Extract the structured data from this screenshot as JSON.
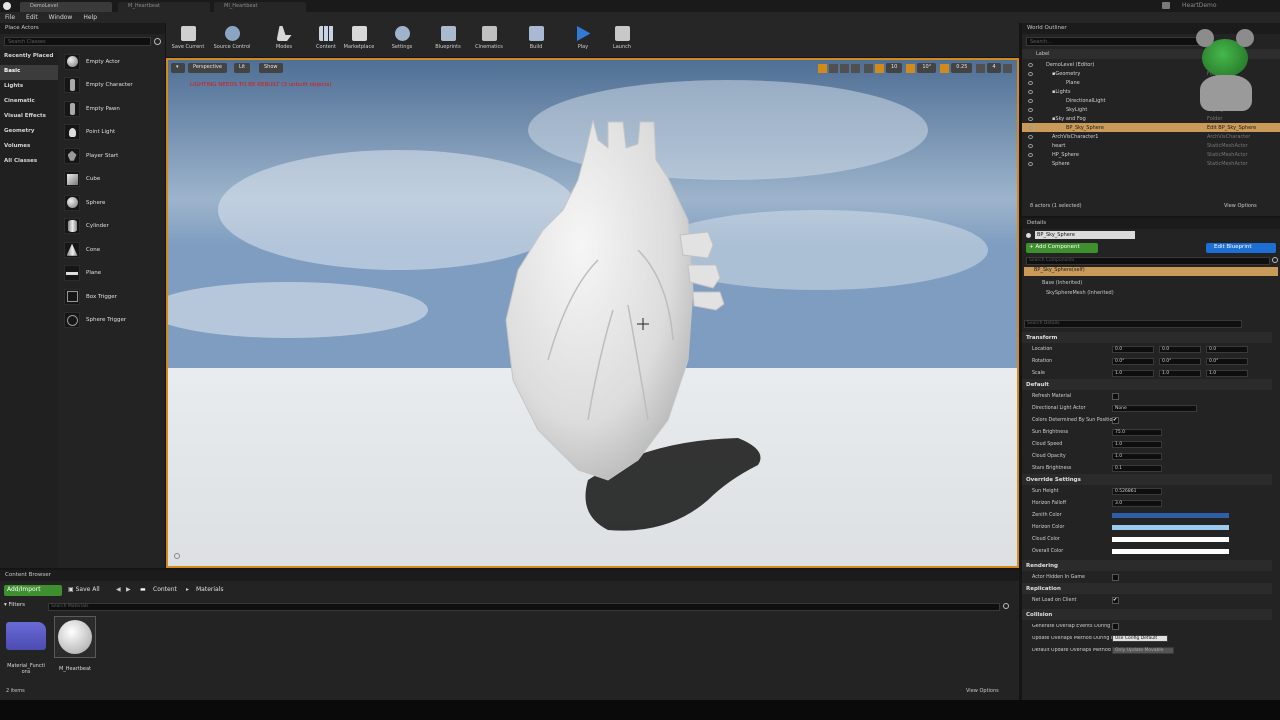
{
  "titlebar": {
    "tabs": [
      "DemoLevel",
      "M_Heartbeat",
      "MI_Heartbeat"
    ],
    "project": "HeartDemo"
  },
  "menubar": {
    "items": [
      "File",
      "Edit",
      "Window",
      "Help"
    ]
  },
  "place_actors": {
    "title": "Place Actors",
    "search_placeholder": "Search Classes",
    "categories": [
      "Recently Placed",
      "Basic",
      "Lights",
      "Cinematic",
      "Visual Effects",
      "Geometry",
      "Volumes",
      "All Classes"
    ],
    "selected_category": "Basic",
    "actors": [
      "Empty Actor",
      "Empty Character",
      "Empty Pawn",
      "Point Light",
      "Player Start",
      "Cube",
      "Sphere",
      "Cylinder",
      "Cone",
      "Plane",
      "Box Trigger",
      "Sphere Trigger"
    ]
  },
  "toolbar": {
    "buttons": [
      "Save Current",
      "Source Control",
      "Modes",
      "Content",
      "Marketplace",
      "Settings",
      "Blueprints",
      "Cinematics",
      "Build",
      "Play",
      "Launch"
    ]
  },
  "viewport": {
    "perspective": "Perspective",
    "lit": "Lit",
    "show": "Show",
    "warning": "LIGHTING NEEDS TO BE REBUILT (3 unbuilt objects)",
    "grid": "10",
    "angle": "10°",
    "scale": "0.25",
    "camera": "4"
  },
  "outliner": {
    "title": "World Outliner",
    "search_placeholder": "Search...",
    "col_label": "Label",
    "col_type": "Type",
    "rows": [
      {
        "label": "DemoLevel (Editor)",
        "type": "World"
      },
      {
        "label": "Geometry",
        "type": "Folder"
      },
      {
        "label": "Plane",
        "type": "StaticMeshActor"
      },
      {
        "label": "Lights",
        "type": "Folder"
      },
      {
        "label": "DirectionalLight",
        "type": "DirectionalLight"
      },
      {
        "label": "SkyLight",
        "type": "SkyLight"
      },
      {
        "label": "Sky and Fog",
        "type": "Folder"
      },
      {
        "label": "BP_Sky_Sphere",
        "type": "Edit BP_Sky_Sphere"
      },
      {
        "label": "ArchVisCharacter1",
        "type": "ArchVisCharacter"
      },
      {
        "label": "heart",
        "type": "StaticMeshActor"
      },
      {
        "label": "HP_Sphere",
        "type": "StaticMeshActor"
      },
      {
        "label": "Sphere",
        "type": "StaticMeshActor"
      }
    ],
    "status": "8 actors (1 selected)",
    "view_options": "View Options"
  },
  "details": {
    "title": "Details",
    "name": "BP_Sky_Sphere",
    "add_component": "+ Add Component",
    "edit_blueprint": "Edit Blueprint",
    "search_components": "Search Components",
    "components": [
      "BP_Sky_Sphere(self)",
      "Base (Inherited)",
      "SkySphereMesh (Inherited)"
    ],
    "search_details": "Search Details",
    "transform": {
      "title": "Transform",
      "location": [
        "0.0",
        "0.0",
        "0.0"
      ],
      "rotation": [
        "0.0°",
        "0.0°",
        "0.0°"
      ],
      "scale": [
        "1.0",
        "1.0",
        "1.0"
      ],
      "labels": [
        "Location",
        "Rotation",
        "Scale"
      ]
    },
    "default": {
      "title": "Default",
      "props": [
        {
          "label": "Refresh Material",
          "type": "check",
          "value": ""
        },
        {
          "label": "Directional Light Actor",
          "type": "select",
          "value": "None"
        },
        {
          "label": "Colors Determined By Sun Position",
          "type": "check",
          "value": "✔"
        },
        {
          "label": "Sun Brightness",
          "type": "num",
          "value": "75.0"
        },
        {
          "label": "Cloud Speed",
          "type": "num",
          "value": "1.0"
        },
        {
          "label": "Cloud Opacity",
          "type": "num",
          "value": "1.0"
        },
        {
          "label": "Stars Brightness",
          "type": "num",
          "value": "0.1"
        }
      ]
    },
    "override": {
      "title": "Override Settings",
      "props": [
        {
          "label": "Sun Height",
          "value": "0.526861",
          "color": ""
        },
        {
          "label": "Horizon Falloff",
          "value": "3.0",
          "color": ""
        },
        {
          "label": "Zenith Color",
          "value": "",
          "color": "#2e5fa6"
        },
        {
          "label": "Horizon Color",
          "value": "",
          "color": "#9cc9ee"
        },
        {
          "label": "Cloud Color",
          "value": "",
          "color": "#ffffff"
        },
        {
          "label": "Overall Color",
          "value": "",
          "color": "#ffffff"
        }
      ]
    },
    "rendering": {
      "title": "Rendering",
      "prop": "Actor Hidden In Game"
    },
    "replication": {
      "title": "Replication",
      "prop": "Net Load on Client",
      "value": "✔"
    },
    "collision": {
      "title": "Collision",
      "props": [
        {
          "label": "Generate Overlap Events During Level Streaming",
          "value": ""
        },
        {
          "label": "Update Overlaps Method During Level Streaming",
          "value": "Use Config Default"
        },
        {
          "label": "Default Update Overlaps Method",
          "value": "Only Update Movable"
        }
      ]
    }
  },
  "content_browser": {
    "title": "Content Browser",
    "add_import": "Add/Import",
    "save_all": "Save All",
    "path": [
      "Content",
      "Materials"
    ],
    "filters": "Filters",
    "search_placeholder": "Search Materials",
    "assets": [
      {
        "label": "Material_Functions",
        "type": "folder"
      },
      {
        "label": "M_Heartbeat",
        "type": "material"
      }
    ],
    "count": "2 items",
    "view_options": "View Options"
  },
  "colors": {
    "accent": "#d28a1a",
    "selection": "#c99a58",
    "add_green": "#3e8f2e",
    "blueprint_blue": "#1d6fd6"
  }
}
